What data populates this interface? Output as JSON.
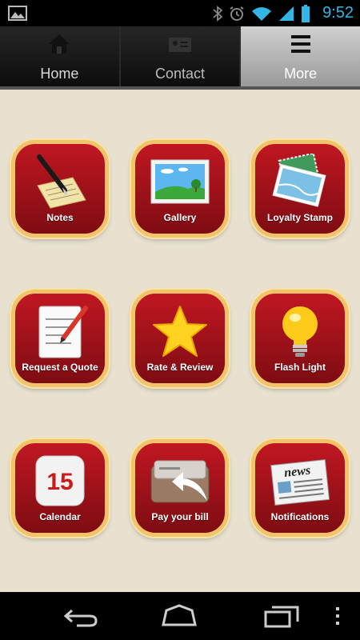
{
  "status_bar": {
    "time": "9:52",
    "icons": [
      "image-icon",
      "bluetooth-icon",
      "alarm-icon",
      "wifi-icon",
      "signal-icon",
      "battery-icon"
    ]
  },
  "tabs": [
    {
      "label": "Home",
      "icon": "home-icon",
      "active": false
    },
    {
      "label": "Contact",
      "icon": "contact-card-icon",
      "active": false
    },
    {
      "label": "More",
      "icon": "menu-icon",
      "active": true
    }
  ],
  "tiles": [
    {
      "label": "Notes",
      "icon": "notes-icon"
    },
    {
      "label": "Gallery",
      "icon": "gallery-icon"
    },
    {
      "label": "Loyalty Stamp",
      "icon": "stamp-icon"
    },
    {
      "label": "Request a Quote",
      "icon": "quote-icon"
    },
    {
      "label": "Rate & Review",
      "icon": "star-icon"
    },
    {
      "label": "Flash Light",
      "icon": "lightbulb-icon"
    },
    {
      "label": "Calendar",
      "icon": "calendar-icon",
      "badge": "15"
    },
    {
      "label": "Pay your bill",
      "icon": "pay-bill-icon"
    },
    {
      "label": "Notifications",
      "icon": "newspaper-icon",
      "badge": "news"
    }
  ],
  "nav_bar": [
    "back-icon",
    "home-nav-icon",
    "recent-apps-icon",
    "overflow-menu-icon"
  ],
  "colors": {
    "accent": "#33b5e5",
    "tile_fill": "#a3111b",
    "tile_border": "#f1c36b",
    "background": "#e8e1d0"
  }
}
